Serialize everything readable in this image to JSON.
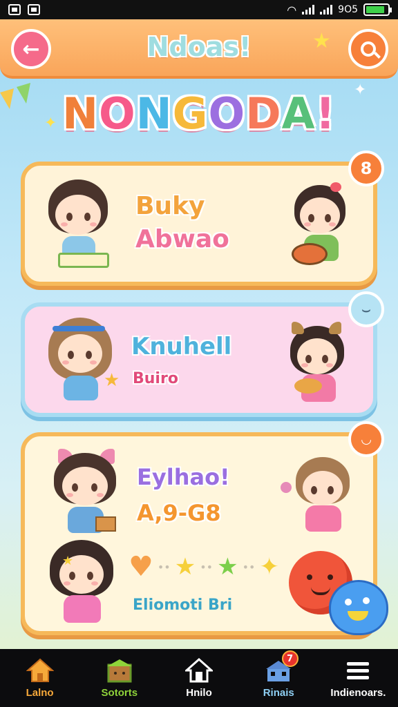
{
  "status_bar": {
    "time": "9O5",
    "battery_level": 0.85
  },
  "header": {
    "title": "Ndoas!",
    "back_icon": "arrow-left-icon",
    "search_icon": "search-icon"
  },
  "banner_title": "NONGODA!",
  "cards": [
    {
      "line1": "Buky",
      "line2": "Abwao",
      "badge": "8",
      "colors": {
        "line1": "#f3a33c",
        "line2": "#f0729a",
        "badge": "#f7803a"
      }
    },
    {
      "line1": "Knuhell",
      "line2": "Buiro",
      "badge": "",
      "colors": {
        "line1": "#4fb2dc",
        "line2": "#e14a7a",
        "badge": "#b6e3f4"
      }
    },
    {
      "line1": "Eylhao!",
      "line2": "A,9-G8",
      "line3": "Eliomoti Bri",
      "badge": "",
      "colors": {
        "line1": "#9a6fe0",
        "line2": "#f4962f",
        "line3": "#3aa5c8",
        "badge": "#f7803a"
      }
    }
  ],
  "tabs": [
    {
      "label": "Lalno",
      "color": "#f7a93a",
      "icon": "home-icon"
    },
    {
      "label": "Sotorts",
      "color": "#8fd33a",
      "icon": "shop-icon"
    },
    {
      "label": "Hnilo",
      "color": "#ffffff",
      "icon": "house-icon"
    },
    {
      "label": "Rinais",
      "color": "#8fd0f4",
      "icon": "building-icon",
      "badge": "7"
    },
    {
      "label": "Indienoars.",
      "color": "#ffffff",
      "icon": "menu-icon"
    }
  ]
}
